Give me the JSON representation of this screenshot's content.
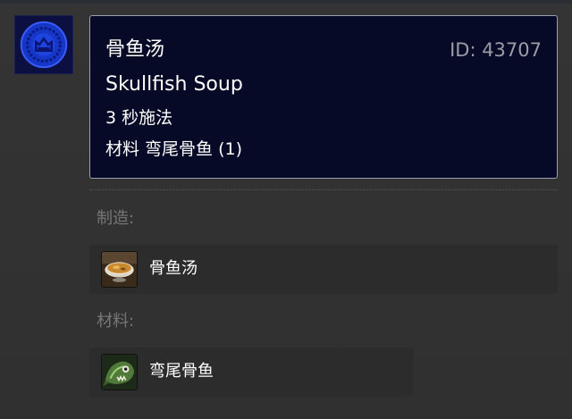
{
  "spell": {
    "name": "骨鱼汤",
    "id_text": "ID: 43707",
    "english_name": "Skullfish Soup",
    "cast_time": "3 秒施法",
    "reagents_line": "材料 弯尾骨鱼 (1)",
    "icon": "blue-rune-seal-icon"
  },
  "creates": {
    "label": "制造:",
    "items": [
      {
        "name": "骨鱼汤",
        "icon": "soup-bowl-icon"
      }
    ]
  },
  "reagents": {
    "label": "材料:",
    "items": [
      {
        "name": "弯尾骨鱼",
        "icon": "skullfish-icon"
      }
    ]
  },
  "colors": {
    "tooltip_bg": "#070a26",
    "tooltip_border": "#9aa0b4",
    "id_text": "#9a9ca6",
    "section_label": "#777777",
    "page_bg": "#333333"
  }
}
